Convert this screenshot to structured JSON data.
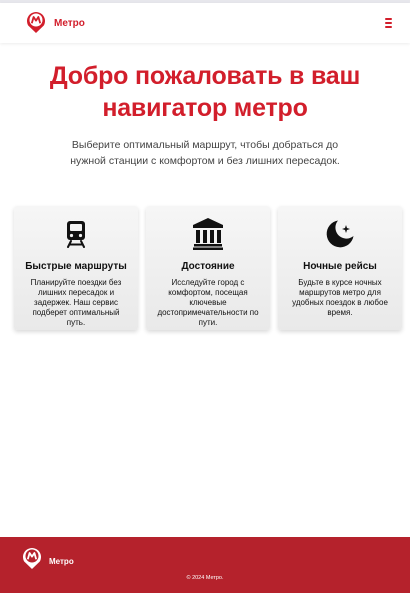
{
  "header": {
    "brand_name": "Метро",
    "menu_icon": "hamburger-icon",
    "accent_color": "#d21e2b"
  },
  "hero": {
    "title": "Добро пожаловать в ваш навигатор метро",
    "subtitle": "Выберите оптимальный маршрут, чтобы добраться до нужной станции с комфортом и без лишних пересадок."
  },
  "cards": [
    {
      "icon": "train-icon",
      "title": "Быстрые маршруты",
      "text": "Планируйте поездки без лишних пересадок и задержек. Наш сервис подберет оптимальный путь."
    },
    {
      "icon": "landmark-icon",
      "title": "Достояние",
      "text": "Исследуйте город с комфортом, посещая ключевые достопримечательности по пути."
    },
    {
      "icon": "moon-stars-icon",
      "title": "Ночные рейсы",
      "text": "Будьте в курсе ночных маршрутов метро для удобных поездок в любое время."
    }
  ],
  "footer": {
    "brand_name": "Метро",
    "copyright": "© 2024 Метро.",
    "background_color": "#b5222c"
  }
}
